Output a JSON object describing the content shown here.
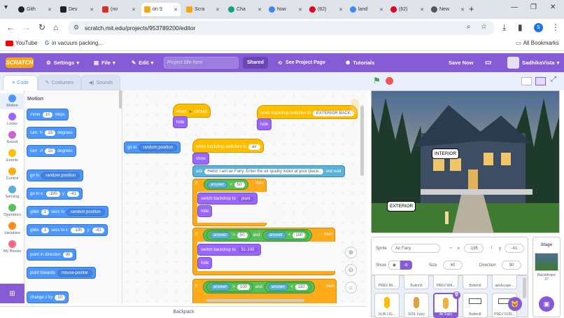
{
  "browser": {
    "tabs": [
      {
        "label": "Gith",
        "color": "#222"
      },
      {
        "label": "Dev",
        "color": "#222"
      },
      {
        "label": "(no",
        "color": "#d93025"
      },
      {
        "label": "on S",
        "color": "#f7a416"
      },
      {
        "label": "Scra",
        "color": "#f7a416"
      },
      {
        "label": "Cha",
        "color": "#10a37f"
      },
      {
        "label": "how",
        "color": "#4285f4"
      },
      {
        "label": "(62)",
        "color": "#e60023"
      },
      {
        "label": "land",
        "color": "#4285f4"
      },
      {
        "label": "(62)",
        "color": "#e60023"
      },
      {
        "label": "New",
        "color": "#555"
      }
    ],
    "active_tab": 3,
    "url": "scratch.mit.edu/projects/953789200/editor",
    "profile_initial": "S",
    "bookmarks": [
      {
        "label": "YouTube"
      },
      {
        "label": "in vacuum packing..."
      }
    ],
    "all_bookmarks": "All Bookmarks"
  },
  "menu": {
    "logo": "SCRATCH",
    "settings": "Settings",
    "file": "File",
    "edit": "Edit",
    "title_placeholder": "Project title here",
    "shared": "Shared",
    "see_project": "See Project Page",
    "tutorials": "Tutorials",
    "save_now": "Save Now",
    "username": "SadhikaVista"
  },
  "editor_tabs": {
    "code": "Code",
    "costumes": "Costumes",
    "sounds": "Sounds"
  },
  "categories": [
    {
      "label": "Motion",
      "color": "#4c97ff"
    },
    {
      "label": "Looks",
      "color": "#9966ff"
    },
    {
      "label": "Sound",
      "color": "#cf63cf"
    },
    {
      "label": "Events",
      "color": "#ffbf00"
    },
    {
      "label": "Control",
      "color": "#ffab19"
    },
    {
      "label": "Sensing",
      "color": "#5cb1d6"
    },
    {
      "label": "Operators",
      "color": "#59c059"
    },
    {
      "label": "Variables",
      "color": "#ff8c1a"
    },
    {
      "label": "My Blocks",
      "color": "#ff6680"
    }
  ],
  "palette": {
    "heading": "Motion",
    "move": {
      "a": "move",
      "v": "10",
      "b": "steps"
    },
    "turn_right": {
      "a": "turn",
      "v": "15",
      "b": "degrees"
    },
    "turn_left": {
      "a": "turn",
      "v": "15",
      "b": "degrees"
    },
    "goto": {
      "a": "go to",
      "dd": "random position"
    },
    "gotoxy": {
      "a": "go to x:",
      "x": "-195",
      "b": "y:",
      "y": "-41"
    },
    "glide1": {
      "a": "glide",
      "v": "1",
      "b": "secs to",
      "dd": "random position"
    },
    "glide2": {
      "a": "glide",
      "v": "1",
      "b": "secs to x:",
      "x": "-195",
      "c": "y:",
      "y": "-41"
    },
    "point_dir": {
      "a": "point in direction",
      "v": "90"
    },
    "point_towards": {
      "a": "point towards",
      "dd": "mouse-pointer"
    },
    "change_x": {
      "a": "change x by",
      "v": "10"
    }
  },
  "scripts": {
    "flag_hat": {
      "a": "when",
      "b": "clicked"
    },
    "hide1": "hide",
    "goto_loose": {
      "a": "go to",
      "dd": "random position"
    },
    "backdrop_hat1": {
      "a": "when backdrop switches to",
      "dd": "EXTERIOR BACK"
    },
    "hide2": "hide",
    "backdrop_hat2": {
      "a": "when backdrop switches to",
      "dd": "air"
    },
    "show": "show",
    "ask": {
      "a": "ask",
      "v": "Hello! I am air Fairy. Enter the air quality index at your place..",
      "b": "and wait"
    },
    "if1": {
      "a": "if",
      "left": "answer",
      "op": "<",
      "right": "50",
      "b": "then"
    },
    "switch1": {
      "a": "switch backdrop to",
      "dd": "plant"
    },
    "hide3": "hide",
    "if2": {
      "a": "if",
      "l1": "answer",
      "op1": ">",
      "r1": "50",
      "and": "and",
      "l2": "answer",
      "op2": "<",
      "r2": "100",
      "b": "then"
    },
    "switch2": {
      "a": "switch backdrop to",
      "dd": "51-100"
    },
    "hide4": "hide",
    "if3": {
      "a": "if",
      "l1": "answer",
      "op1": ">",
      "r1": "100",
      "and": "and",
      "l2": "answer",
      "op2": "<",
      "r2": "150",
      "b": "then"
    }
  },
  "backpack": "Backpack",
  "stage": {
    "label_interior": "INTERIOR",
    "label_exterior": "EXTERIOR"
  },
  "sprite_info": {
    "sprite_label": "Sprite",
    "sprite_name": "Air Fairy",
    "x_label": "x",
    "x": "-195",
    "y_label": "y",
    "y": "-41",
    "show_label": "Show",
    "size_label": "Size",
    "size": "40",
    "direction_label": "Direction",
    "direction": "90"
  },
  "sprites": [
    {
      "name": "PREV MI..."
    },
    {
      "name": "Button5"
    },
    {
      "name": "PREV WA..."
    },
    {
      "name": "Button6"
    },
    {
      "name": "landscape..."
    },
    {
      "name": "SUN LIG..."
    },
    {
      "name": "SOIL Fairy"
    },
    {
      "name": "Air Fairy"
    },
    {
      "name": "Button8"
    },
    {
      "name": "PREV FOR..."
    }
  ],
  "stage_panel": {
    "title": "Stage",
    "backdrops_label": "Backdrops",
    "backdrops_count": "37"
  }
}
